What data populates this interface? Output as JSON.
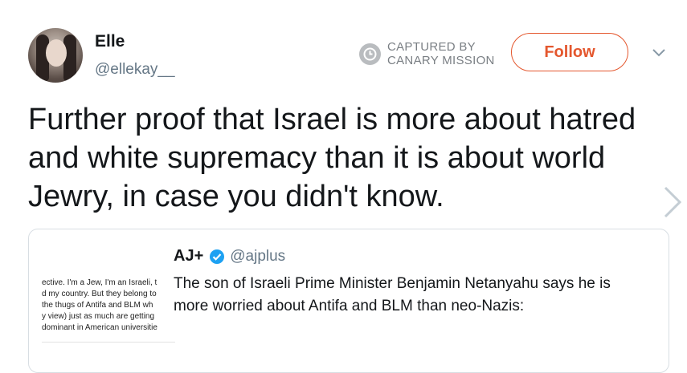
{
  "author": {
    "name": "Elle",
    "handle": "@ellekay__"
  },
  "watermark": {
    "line1": "CAPTURED BY",
    "line2": "CANARY MISSION"
  },
  "follow_label": "Follow",
  "tweet_text": "Further proof that Israel is more about hatred and white supremacy than it is about world Jewry, in case you didn't know.",
  "quoted": {
    "name": "AJ+",
    "handle": "@ajplus",
    "text": "The son of Israeli Prime Minister Benjamin Netanyahu says he is more worried about Antifa and BLM than neo-Nazis:",
    "image_lines": [
      "ective. I'm a Jew, I'm an Israeli, t",
      "d my country. But they belong to",
      " the thugs of Antifa and BLM wh",
      "y view) just as much are getting",
      "dominant in American universitie"
    ]
  },
  "colors": {
    "follow": "#e4572e",
    "verified": "#1da1f2",
    "muted": "#657786"
  }
}
